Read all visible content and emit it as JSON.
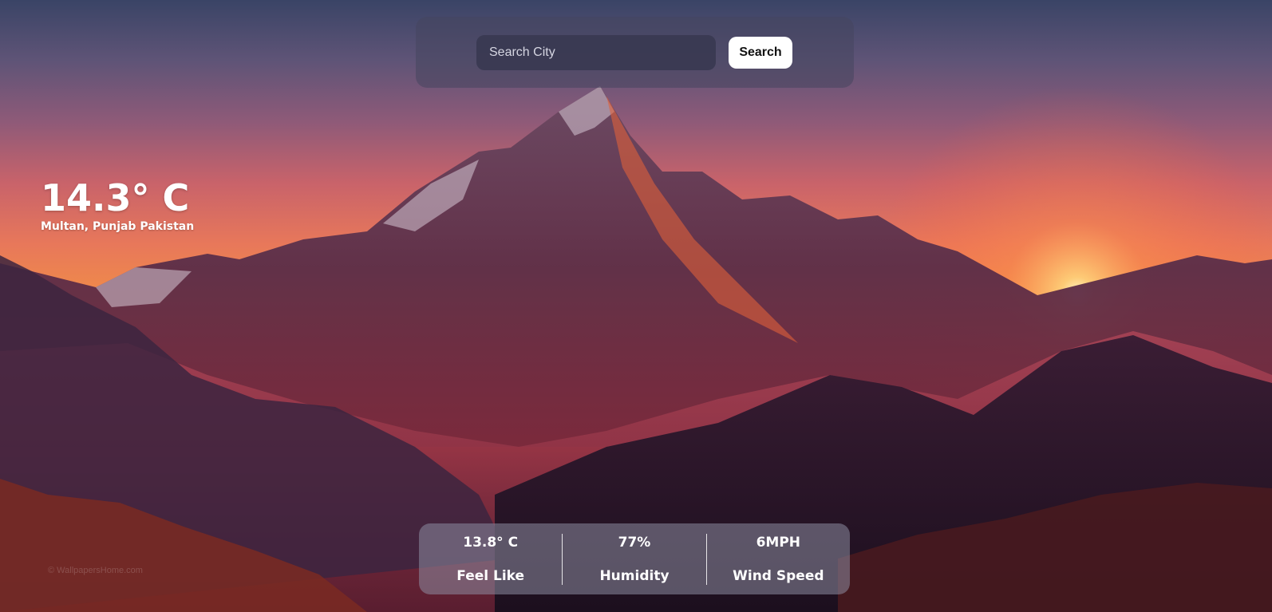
{
  "search": {
    "placeholder": "Search City",
    "value": "",
    "button_label": "Search"
  },
  "weather": {
    "temperature": "14.3° C",
    "location": "Multan, Punjab Pakistan"
  },
  "stats": [
    {
      "value": "13.8° C",
      "label": "Feel Like"
    },
    {
      "value": "77%",
      "label": "Humidity"
    },
    {
      "value": "6MPH",
      "label": "Wind Speed"
    }
  ],
  "background": {
    "watermark": "© WallpapersHome.com"
  }
}
